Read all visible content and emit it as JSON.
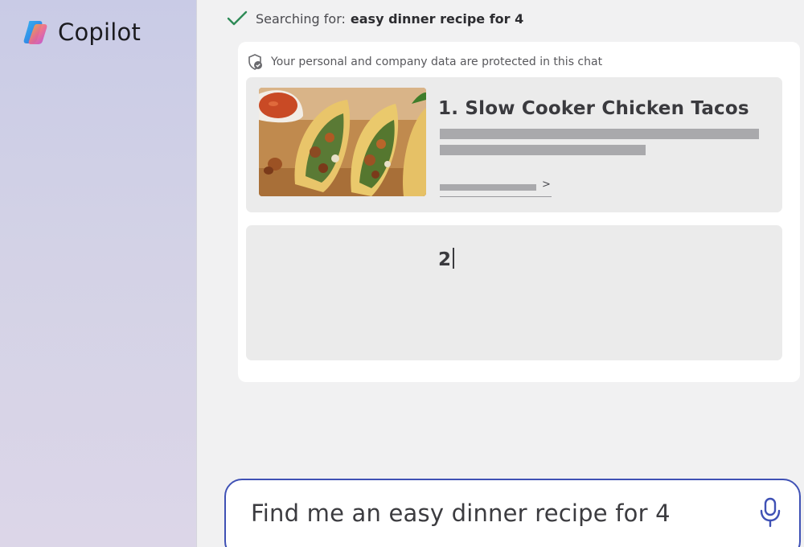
{
  "brand": {
    "name": "Copilot",
    "logo_icon": "copilot-logo-icon"
  },
  "search_status": {
    "icon": "check-icon",
    "prefix": "Searching for:",
    "query": "easy dinner recipe for 4"
  },
  "privacy_notice": {
    "icon": "shield-check-icon",
    "text": "Your personal and company data are protected in this chat"
  },
  "results": [
    {
      "title": "1. Slow Cooker Chicken Tacos",
      "image_icon": "tacos-photo",
      "link_arrow": ">"
    },
    {
      "title": "2"
    }
  ],
  "chat_input": {
    "value": "Find me an easy dinner recipe for 4",
    "mic_icon": "microphone-icon"
  },
  "colors": {
    "accent": "#3f51b5",
    "check": "#2e8b57",
    "card_bg": "#ebebeb",
    "placeholder": "#a9a9ac"
  }
}
